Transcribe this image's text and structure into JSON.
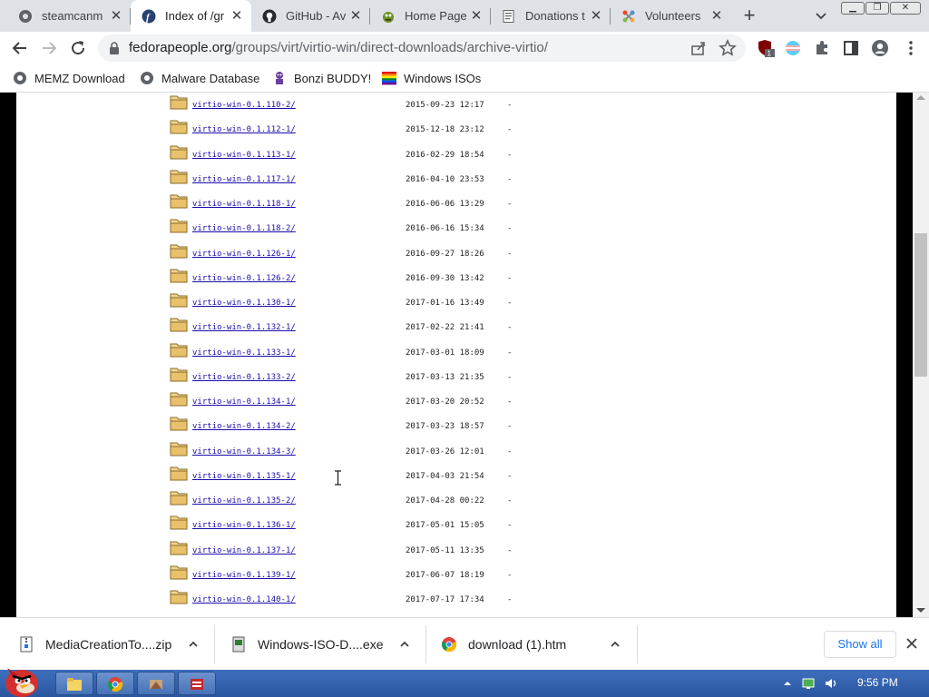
{
  "tabs": [
    {
      "title": "steamcanm",
      "icon": "globe-icon",
      "active": false
    },
    {
      "title": "Index of /gr",
      "icon": "fedora-icon",
      "active": true
    },
    {
      "title": "GitHub - Av",
      "icon": "github-icon",
      "active": false
    },
    {
      "title": "Home Page",
      "icon": "mascot-icon",
      "active": false
    },
    {
      "title": "Donations t",
      "icon": "document-icon",
      "active": false
    },
    {
      "title": "Volunteers",
      "icon": "joomla-icon",
      "active": false
    }
  ],
  "toolbar": {
    "url_host": "fedorapeople.org",
    "url_path": "/groups/virt/virtio-win/direct-downloads/archive-virtio/",
    "extension_badge": "1"
  },
  "bookmarks": [
    {
      "label": "MEMZ Download",
      "icon": "globe-icon"
    },
    {
      "label": "Malware Database",
      "icon": "globe-icon"
    },
    {
      "label": "Bonzi BUDDY!",
      "icon": "bonzi-icon"
    },
    {
      "label": "Windows ISOs",
      "icon": "windows-flag-icon"
    }
  ],
  "listing": [
    {
      "name": "virtio-win-0.1.110-2/",
      "date": "2015-09-23 12:17",
      "size": "-"
    },
    {
      "name": "virtio-win-0.1.112-1/",
      "date": "2015-12-18 23:12",
      "size": "-"
    },
    {
      "name": "virtio-win-0.1.113-1/",
      "date": "2016-02-29 18:54",
      "size": "-"
    },
    {
      "name": "virtio-win-0.1.117-1/",
      "date": "2016-04-10 23:53",
      "size": "-"
    },
    {
      "name": "virtio-win-0.1.118-1/",
      "date": "2016-06-06 13:29",
      "size": "-"
    },
    {
      "name": "virtio-win-0.1.118-2/",
      "date": "2016-06-16 15:34",
      "size": "-"
    },
    {
      "name": "virtio-win-0.1.126-1/",
      "date": "2016-09-27 18:26",
      "size": "-"
    },
    {
      "name": "virtio-win-0.1.126-2/",
      "date": "2016-09-30 13:42",
      "size": "-"
    },
    {
      "name": "virtio-win-0.1.130-1/",
      "date": "2017-01-16 13:49",
      "size": "-"
    },
    {
      "name": "virtio-win-0.1.132-1/",
      "date": "2017-02-22 21:41",
      "size": "-"
    },
    {
      "name": "virtio-win-0.1.133-1/",
      "date": "2017-03-01 18:09",
      "size": "-"
    },
    {
      "name": "virtio-win-0.1.133-2/",
      "date": "2017-03-13 21:35",
      "size": "-"
    },
    {
      "name": "virtio-win-0.1.134-1/",
      "date": "2017-03-20 20:52",
      "size": "-"
    },
    {
      "name": "virtio-win-0.1.134-2/",
      "date": "2017-03-23 18:57",
      "size": "-"
    },
    {
      "name": "virtio-win-0.1.134-3/",
      "date": "2017-03-26 12:01",
      "size": "-"
    },
    {
      "name": "virtio-win-0.1.135-1/",
      "date": "2017-04-03 21:54",
      "size": "-"
    },
    {
      "name": "virtio-win-0.1.135-2/",
      "date": "2017-04-28 00:22",
      "size": "-"
    },
    {
      "name": "virtio-win-0.1.136-1/",
      "date": "2017-05-01 15:05",
      "size": "-"
    },
    {
      "name": "virtio-win-0.1.137-1/",
      "date": "2017-05-11 13:35",
      "size": "-"
    },
    {
      "name": "virtio-win-0.1.139-1/",
      "date": "2017-06-07 18:19",
      "size": "-"
    },
    {
      "name": "virtio-win-0.1.140-1/",
      "date": "2017-07-17 17:34",
      "size": "-"
    }
  ],
  "downloads": [
    {
      "name": "MediaCreationTo....zip",
      "icon": "zip-file-icon"
    },
    {
      "name": "Windows-ISO-D....exe",
      "icon": "exe-file-icon"
    },
    {
      "name": "download (1).htm",
      "icon": "chrome-icon"
    }
  ],
  "download_bar": {
    "show_all": "Show all"
  },
  "taskbar": {
    "clock": "9:56 PM"
  },
  "colors": {
    "link": "#1a0dab",
    "accent": "#1a73e8",
    "taskbar": "#2a56a0"
  }
}
